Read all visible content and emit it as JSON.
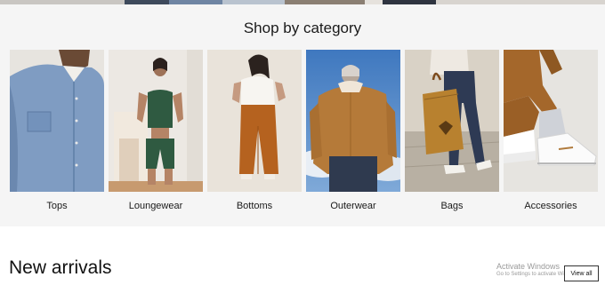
{
  "category_section": {
    "title": "Shop by category",
    "items": [
      {
        "label": "Tops",
        "image": "chambray-shirt-photo"
      },
      {
        "label": "Loungewear",
        "image": "green-activewear-photo"
      },
      {
        "label": "Bottoms",
        "image": "rust-pants-photo"
      },
      {
        "label": "Outerwear",
        "image": "tan-jacket-photo"
      },
      {
        "label": "Bags",
        "image": "tote-bag-photo"
      },
      {
        "label": "Accessories",
        "image": "sneakers-socks-photo"
      }
    ]
  },
  "new_arrivals": {
    "title": "New arrivals",
    "view_all_label": "View all"
  },
  "watermark": {
    "title": "Activate Windows",
    "subtitle": "Go to Settings to activate Windows."
  },
  "colors": {
    "section_bg": "#f5f5f5",
    "text": "#1a1a1a"
  }
}
